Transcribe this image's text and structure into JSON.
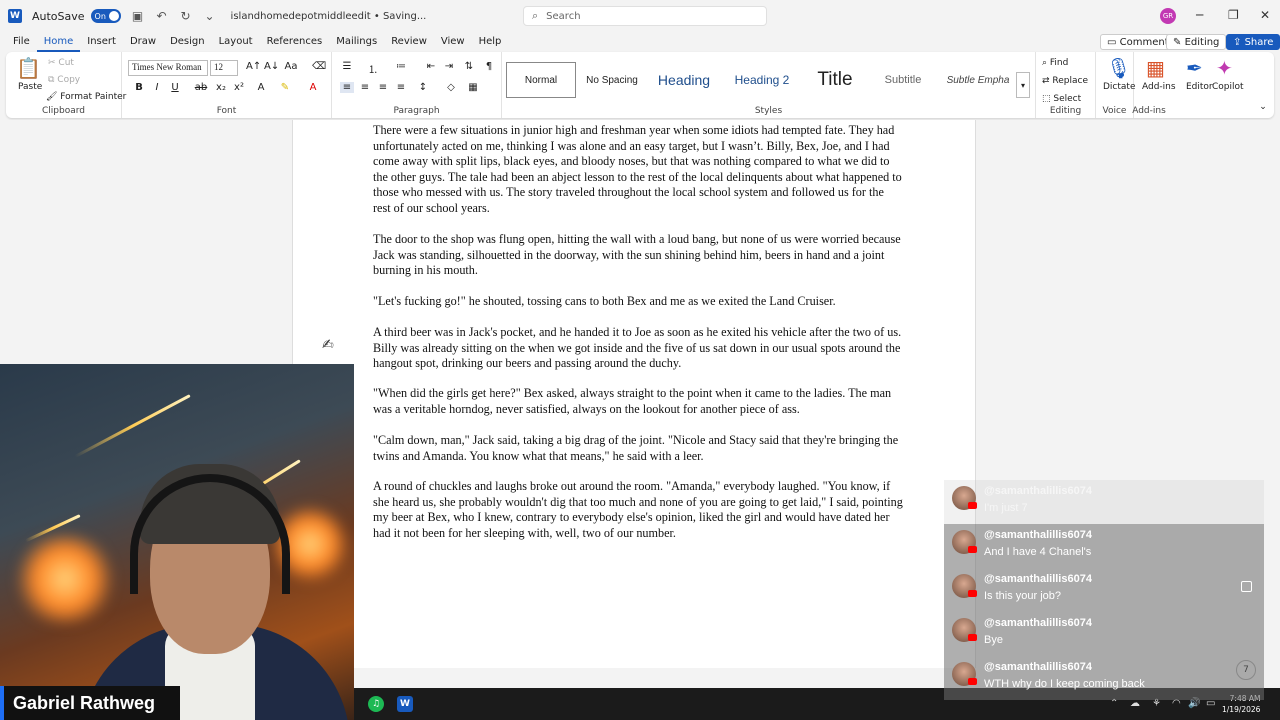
{
  "titlebar": {
    "autosave_label": "AutoSave",
    "autosave_state": "On",
    "doc_title": "islandhomedepotmiddleedit • Saving...",
    "search_placeholder": "Search",
    "avatar_initials": "GR"
  },
  "menu": {
    "tabs": [
      "File",
      "Home",
      "Insert",
      "Draw",
      "Design",
      "Layout",
      "References",
      "Mailings",
      "Review",
      "View",
      "Help"
    ],
    "comments": "Comments",
    "editing": "Editing",
    "share": "Share"
  },
  "ribbon": {
    "clipboard": {
      "paste": "Paste",
      "cut": "Cut",
      "copy": "Copy",
      "format_painter": "Format Painter",
      "label": "Clipboard"
    },
    "font": {
      "family": "Times New Roman",
      "size": "12",
      "label": "Font"
    },
    "paragraph": {
      "label": "Paragraph"
    },
    "styles": {
      "normal": "Normal",
      "no_spacing": "No Spacing",
      "heading": "Heading",
      "heading2": "Heading 2",
      "title": "Title",
      "subtitle": "Subtitle",
      "subtle_emphasis": "Subtle Empha",
      "label": "Styles"
    },
    "editing": {
      "find": "Find",
      "replace": "Replace",
      "select": "Select",
      "label": "Editing"
    },
    "voice": {
      "dictate": "Dictate",
      "label": "Voice"
    },
    "addins": {
      "addins": "Add-ins",
      "editor": "Editor",
      "copilot": "Copilot",
      "label": "Add-ins"
    }
  },
  "document": {
    "paragraphs": [
      "There were a few situations in junior high and freshman year when some idiots had tempted fate. They had unfortunately acted on me, thinking I was alone and an easy target, but I wasn’t. Billy, Bex, Joe, and I had come away with split lips, black eyes, and bloody noses, but that was nothing compared to what we did to the other guys. The tale had been an abject lesson to the rest of the local delinquents about what happened to those who messed with us. The story traveled throughout the local school system and followed us for the rest of our school years.",
      "The door to the shop was flung open, hitting the wall with a loud bang, but none of us were worried because Jack was standing, silhouetted in the doorway, with the sun shining behind him, beers in hand and a joint burning in his mouth.",
      "\"Let's fucking go!\" he shouted, tossing cans to both Bex and me as we exited the Land Cruiser.",
      "A third beer was in Jack's pocket, and he handed it to Joe as soon as he exited his vehicle after the two of us. Billy was already sitting on the  when we got inside and the five of us sat down in our usual spots around the hangout spot, drinking our beers and passing around the duchy.",
      "\"When did the girls get here?\" Bex asked, always straight to the point when it came to the ladies. The man was a veritable horndog, never satisfied, always on the lookout for another piece of ass.",
      "\"Calm down, man,\" Jack said, taking a big drag of the joint. \"Nicole and Stacy said that they're bringing the twins and Amanda. You know what that means,\" he said with a leer.",
      "A round of chuckles and laughs broke out around the room. \"Amanda,\" everybody laughed. \"You know, if she heard us, she probably wouldn't dig that too much and none of you are going to get laid,\" I said, pointing my beer at Bex, who I knew, contrary to everybody else's opinion, liked the girl and would have dated her had it not been for her sleeping with, well, two of our number."
    ]
  },
  "webcam": {
    "streamer_name": "Gabriel Rathweg"
  },
  "chat": {
    "messages": [
      {
        "user": "@samanthalillis6074",
        "text": "I'm just 7"
      },
      {
        "user": "@samanthalillis6074",
        "text": "And I have 4 Chanel's"
      },
      {
        "user": "@samanthalillis6074",
        "text": "Is this your job?"
      },
      {
        "user": "@samanthalillis6074",
        "text": "Bye"
      },
      {
        "user": "@samanthalillis6074",
        "text": "WTH why do I keep coming back"
      }
    ],
    "counter": "7"
  },
  "taskbar": {
    "time": "7:48 AM",
    "date": "1/19/2026"
  },
  "colors": {
    "accent": "#185abd",
    "name_bar_accent": "#1e6ef5",
    "youtube_red": "#ff0000"
  }
}
